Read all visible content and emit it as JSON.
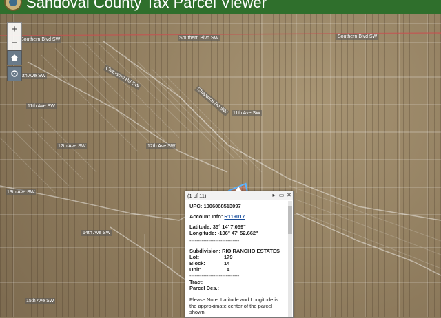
{
  "app": {
    "title": "Sandoval County Tax Parcel Viewer"
  },
  "controls": {
    "zoom_in": "+",
    "zoom_out": "−"
  },
  "streets": [
    {
      "id": "southern1",
      "label": "Southern Blvd SW"
    },
    {
      "id": "southern2",
      "label": "Southern Blvd SW"
    },
    {
      "id": "southern3",
      "label": "Southern Blvd SW"
    },
    {
      "id": "ave10",
      "label": "10th Ave SW"
    },
    {
      "id": "ave11a",
      "label": "11th Ave SW"
    },
    {
      "id": "ave11b",
      "label": "11th Ave SW"
    },
    {
      "id": "ave12a",
      "label": "12th Ave SW"
    },
    {
      "id": "ave12b",
      "label": "12th Ave SW"
    },
    {
      "id": "ave13",
      "label": "13th Ave SW"
    },
    {
      "id": "ave14",
      "label": "14th Ave SW"
    },
    {
      "id": "ave15",
      "label": "15th Ave SW"
    },
    {
      "id": "chaparral",
      "label": "Chaparral Rd SW"
    },
    {
      "id": "chaparral2",
      "label": "Chaparral Rd SW"
    }
  ],
  "popup": {
    "counter": "(1 of 11)",
    "upc_label": "UPC:",
    "upc_value": "1006068513097",
    "account_label": "Account Info:",
    "account_value": "R119017",
    "lat_label": "Latitude:",
    "lat_value": "35° 14' 7.059\"",
    "lon_label": "Longitude:",
    "lon_value": "-106° 47' 52.662\"",
    "divider": "-----------------------------",
    "subdivision_label": "Subdivision:",
    "subdivision_value": "RIO RANCHO ESTATES",
    "lot_label": "Lot:",
    "lot_value": "179",
    "block_label": "Block:",
    "block_value": "14",
    "unit_label": "Unit:",
    "unit_value": "4",
    "tract_label": "Tract:",
    "parcel_desc_label": "Parcel Des.:",
    "note_1": "Please Note: Latitude and Longitude is",
    "note_2": "the approximate center of the parcel",
    "note_3": "shown."
  },
  "icons": [
    "home-icon",
    "locate-icon",
    "maximize-icon",
    "close-icon",
    "next-icon",
    "county-seal-icon"
  ],
  "colors": {
    "header": "#2f6f2c",
    "highlight": "#5ab4ff"
  }
}
